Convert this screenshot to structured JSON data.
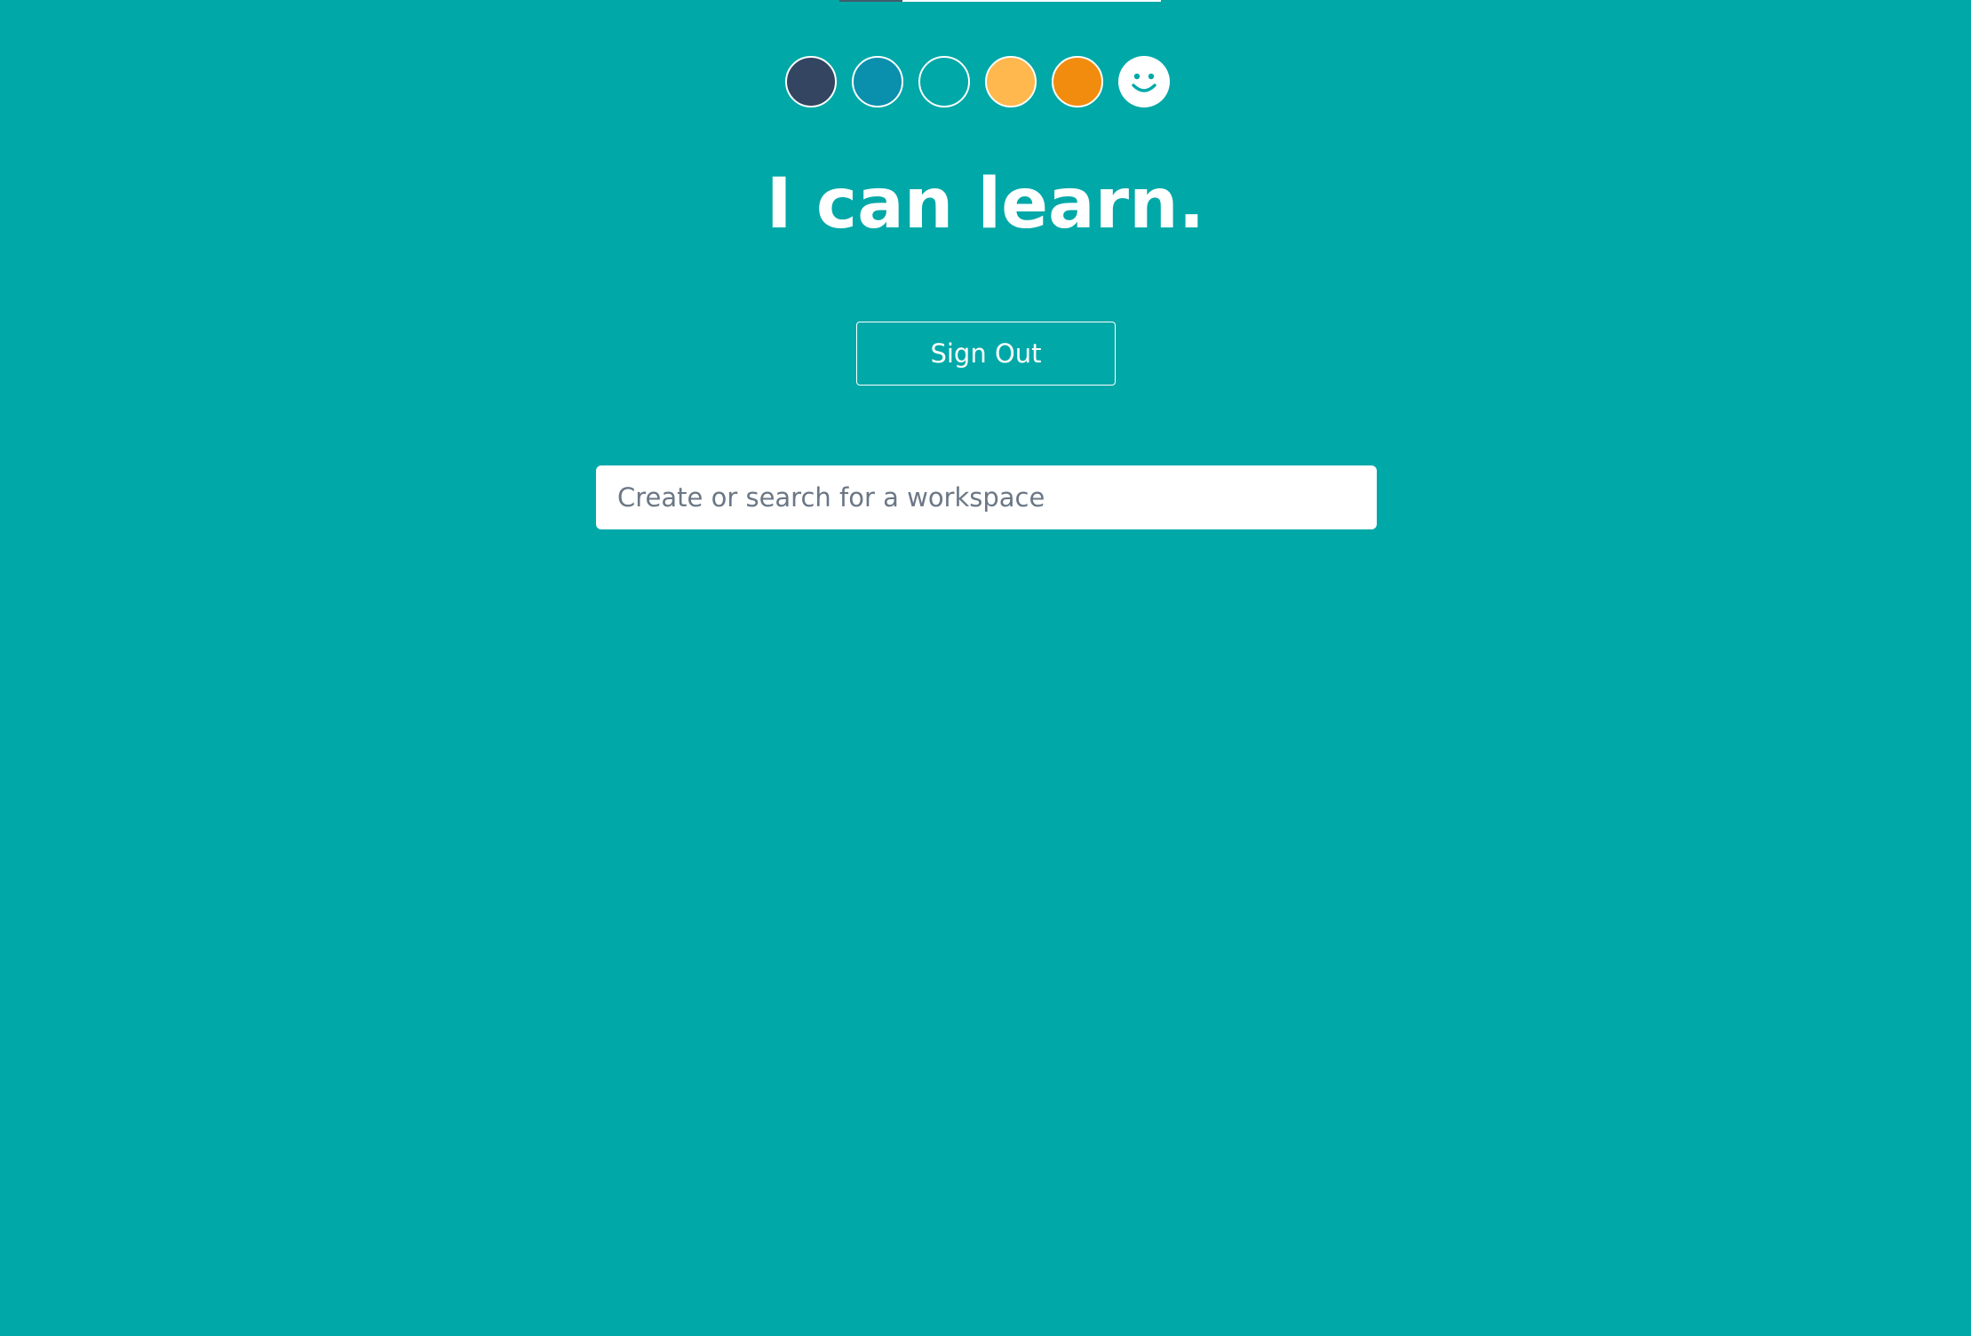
{
  "colors": {
    "background": "#00a8a8",
    "topbar_dark": "#3f5c6b",
    "topbar_light": "#ffffff"
  },
  "swatches": [
    {
      "name": "dark-navy",
      "color": "#334560"
    },
    {
      "name": "blue",
      "color": "#0a8fad"
    },
    {
      "name": "teal",
      "color": "#00a8a8"
    },
    {
      "name": "light-orange",
      "color": "#ffb84d"
    },
    {
      "name": "orange",
      "color": "#f28c0f"
    }
  ],
  "emoji_swatch": {
    "icon": "smiley-icon",
    "fill": "#ffffff",
    "face": "#00a8a8"
  },
  "headline": "I can learn.",
  "signout_label": "Sign Out",
  "search": {
    "placeholder": "Create or search for a workspace",
    "value": ""
  }
}
